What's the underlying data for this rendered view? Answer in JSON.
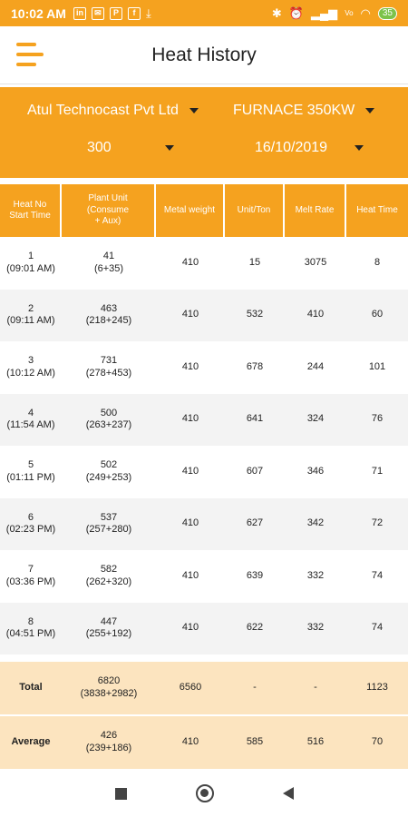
{
  "status_bar": {
    "time": "10:02 AM",
    "battery": "35",
    "left_icons": [
      "linkedin-icon",
      "mail-icon",
      "p-icon",
      "facebook-icon",
      "download-icon"
    ],
    "right_icons": [
      "bluetooth-muted-icon",
      "alarm-icon",
      "signal-icon",
      "volte-icon",
      "wifi-icon",
      "battery-icon"
    ]
  },
  "app_bar": {
    "title": "Heat History",
    "menu_icon": "hamburger-menu-icon"
  },
  "filters": {
    "company": "Atul Technocast Pvt Ltd",
    "furnace": "FURNACE 350KW",
    "number": "300",
    "date": "16/10/2019"
  },
  "table": {
    "headers": [
      "Heat No\nStart Time",
      "Plant Unit\n(Consume\n+ Aux)",
      "Metal weight",
      "Unit/Ton",
      "Melt Rate",
      "Heat Time"
    ],
    "rows": [
      {
        "heat": "1\n(09:01 AM)",
        "plant": "41\n(6+35)",
        "metal": "410",
        "unit": "15",
        "melt": "3075",
        "time": "8"
      },
      {
        "heat": "2\n(09:11 AM)",
        "plant": "463\n(218+245)",
        "metal": "410",
        "unit": "532",
        "melt": "410",
        "time": "60"
      },
      {
        "heat": "3\n(10:12 AM)",
        "plant": "731\n(278+453)",
        "metal": "410",
        "unit": "678",
        "melt": "244",
        "time": "101"
      },
      {
        "heat": "4\n(11:54 AM)",
        "plant": "500\n(263+237)",
        "metal": "410",
        "unit": "641",
        "melt": "324",
        "time": "76"
      },
      {
        "heat": "5\n(01:11 PM)",
        "plant": "502\n(249+253)",
        "metal": "410",
        "unit": "607",
        "melt": "346",
        "time": "71"
      },
      {
        "heat": "6\n(02:23 PM)",
        "plant": "537\n(257+280)",
        "metal": "410",
        "unit": "627",
        "melt": "342",
        "time": "72"
      },
      {
        "heat": "7\n(03:36 PM)",
        "plant": "582\n(262+320)",
        "metal": "410",
        "unit": "639",
        "melt": "332",
        "time": "74"
      },
      {
        "heat": "8\n(04:51 PM)",
        "plant": "447\n(255+192)",
        "metal": "410",
        "unit": "622",
        "melt": "332",
        "time": "74"
      }
    ],
    "total": {
      "label": "Total",
      "plant": "6820\n(3838+2982)",
      "metal": "6560",
      "unit": "-",
      "melt": "-",
      "time": "1123"
    },
    "average": {
      "label": "Average",
      "plant": "426\n(239+186)",
      "metal": "410",
      "unit": "585",
      "melt": "516",
      "time": "70"
    }
  },
  "nav_bar": {
    "icons": [
      "recents-square-icon",
      "home-circle-icon",
      "back-triangle-icon"
    ]
  },
  "colors": {
    "accent": "#f5a21f",
    "summary_bg": "#fce4bf",
    "stripe": "#f3f3f3"
  }
}
